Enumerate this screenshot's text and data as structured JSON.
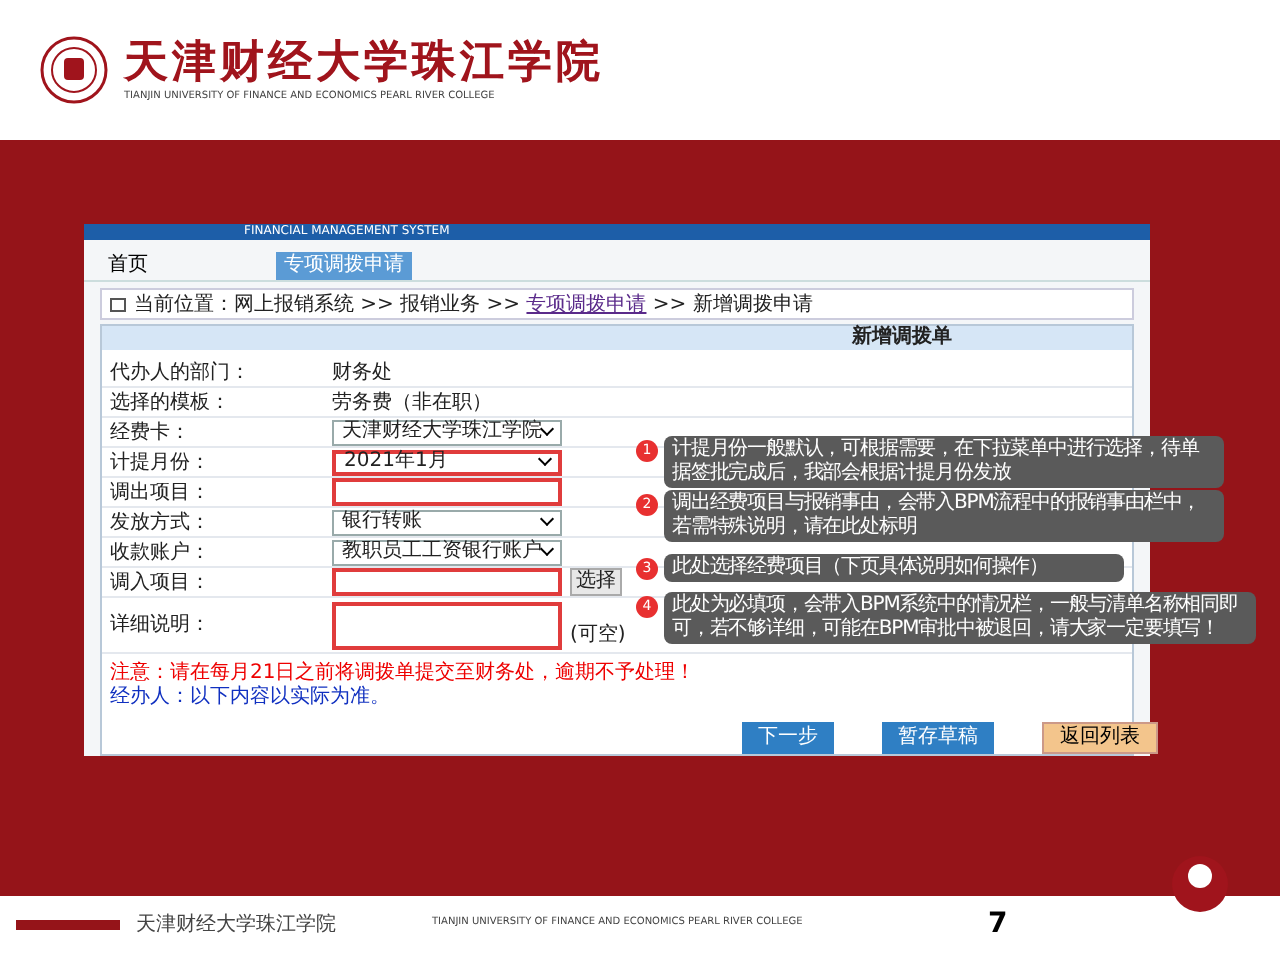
{
  "header": {
    "title": "天津财经大学珠江学院",
    "subtitle": "TIANJIN UNIVERSITY OF FINANCE AND ECONOMICS PEARL RIVER COLLEGE"
  },
  "screenshot": {
    "system_title": "FINANCIAL MANAGEMENT SYSTEM",
    "tabs": [
      {
        "label": "首页",
        "selected": false
      },
      {
        "label": "专项调拨申请",
        "selected": true
      }
    ],
    "breadcrumb": {
      "prefix": "当前位置：网上报销系统 >> 报销业务 >> ",
      "link": "专项调拨申请",
      "suffix": " >> 新增调拨申请"
    },
    "form_title": "新增调拨单",
    "rows": [
      {
        "label": "代办人的部门：",
        "kind": "text",
        "value": "财务处",
        "highlighted": false
      },
      {
        "label": "选择的模板：",
        "kind": "text",
        "value": "劳务费（非在职）",
        "highlighted": false
      },
      {
        "label": "经费卡：",
        "kind": "select",
        "value": "天津财经大学珠江学院",
        "highlighted": false
      },
      {
        "label": "计提月份：",
        "kind": "select",
        "value": "2021年1月",
        "highlighted": true
      },
      {
        "label": "调出项目：",
        "kind": "input",
        "highlighted": true
      },
      {
        "label": "发放方式：",
        "kind": "select",
        "value": "银行转账",
        "highlighted": false
      },
      {
        "label": "收款账户：",
        "kind": "select",
        "value": "教职员工工资银行账户",
        "highlighted": false
      },
      {
        "label": "调入项目：",
        "kind": "input",
        "button": "选择",
        "highlighted": true
      },
      {
        "label": "详细说明：",
        "kind": "textarea",
        "note": "(可空)",
        "highlighted": true
      }
    ],
    "warning": "注意：请在每月21日之前将调拨单提交至财务处，逾期不予处理！",
    "info": "经办人：以下内容以实际为准。",
    "buttons": [
      {
        "label": "下一步",
        "kind": "primary"
      },
      {
        "label": "暂存草稿",
        "kind": "primary"
      },
      {
        "label": "返回列表",
        "kind": "secondary"
      }
    ],
    "callouts": [
      {
        "number": "1",
        "text": "计提月份一般默认，可根据需要，在下拉菜单中进行选择，待单据签批完成后，我部会根据计提月份发放"
      },
      {
        "number": "2",
        "text": "调出经费项目与报销事由，会带入BPM流程中的报销事由栏中，若需特殊说明，请在此处标明"
      },
      {
        "number": "3",
        "text": "此处选择经费项目（下页具体说明如何操作）"
      },
      {
        "number": "4",
        "text": "此处为必填项，会带入BPM系统中的情况栏，一般与清单名称相同即可，若不够详细，可能在BPM审批中被退回，请大家一定要填写！"
      }
    ]
  },
  "footer": {
    "left": "天津财经大学珠江学院",
    "center": "TIANJIN UNIVERSITY OF FINANCE AND ECONOMICS PEARL RIVER COLLEGE",
    "page": "7"
  }
}
